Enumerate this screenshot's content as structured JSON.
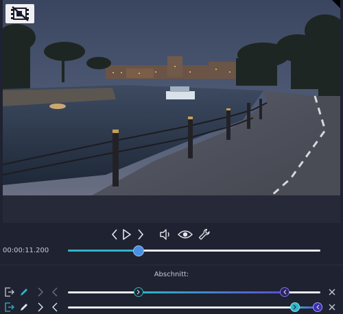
{
  "player": {
    "time": "00:00:11.200",
    "progress_fraction": 0.28
  },
  "icons": {
    "no_crop": "no-crop-film-icon",
    "prev_frame": "chevron-left-icon",
    "play": "play-icon",
    "next_frame": "chevron-right-icon",
    "volume": "volume-icon",
    "preview": "eye-icon",
    "settings": "wrench-icon",
    "export_segment": "export-icon",
    "edit_segment": "pencil-icon",
    "remove_segment": "close-icon"
  },
  "segments": {
    "title": "Abschnitt:",
    "rows": [
      {
        "start_fraction": 0.28,
        "end_fraction": 0.86,
        "active": false
      },
      {
        "start_fraction": 0.9,
        "end_fraction": 0.99,
        "active": true
      }
    ]
  },
  "colors": {
    "accent_cyan": "#31b3cc",
    "accent_purple": "#5a4fd0",
    "knob_blue": "#4a8fe0",
    "background": "#1f2230"
  }
}
